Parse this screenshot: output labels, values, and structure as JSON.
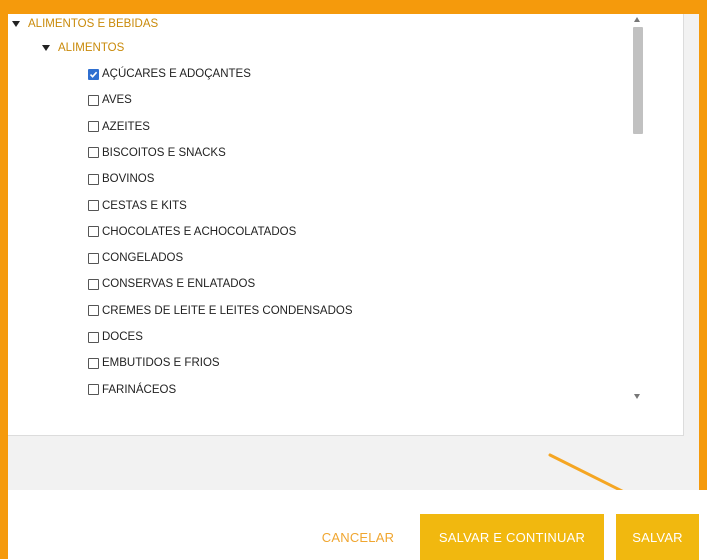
{
  "tree": {
    "root": {
      "label": "ALIMENTOS E BEBIDAS",
      "expanded": true
    },
    "group": {
      "label": "ALIMENTOS",
      "expanded": true
    },
    "items": [
      {
        "label": "AÇÚCARES E ADOÇANTES",
        "checked": true
      },
      {
        "label": "AVES",
        "checked": false
      },
      {
        "label": "AZEITES",
        "checked": false
      },
      {
        "label": "BISCOITOS E SNACKS",
        "checked": false
      },
      {
        "label": "BOVINOS",
        "checked": false
      },
      {
        "label": "CESTAS E KITS",
        "checked": false
      },
      {
        "label": "CHOCOLATES E ACHOCOLATADOS",
        "checked": false
      },
      {
        "label": "CONGELADOS",
        "checked": false
      },
      {
        "label": "CONSERVAS E ENLATADOS",
        "checked": false
      },
      {
        "label": "CREMES DE LEITE E LEITES CONDENSADOS",
        "checked": false
      },
      {
        "label": "DOCES",
        "checked": false
      },
      {
        "label": "EMBUTIDOS E FRIOS",
        "checked": false
      },
      {
        "label": "FARINÁCEOS",
        "checked": false
      }
    ]
  },
  "footer": {
    "cancel_label": "CANCELAR",
    "save_continue_label": "SALVAR E CONTINUAR",
    "save_label": "SALVAR"
  },
  "colors": {
    "frame": "#f59a0c",
    "accent": "#f1b80f",
    "checkbox_checked": "#2f6fd0",
    "arrow": "#f5a623"
  }
}
